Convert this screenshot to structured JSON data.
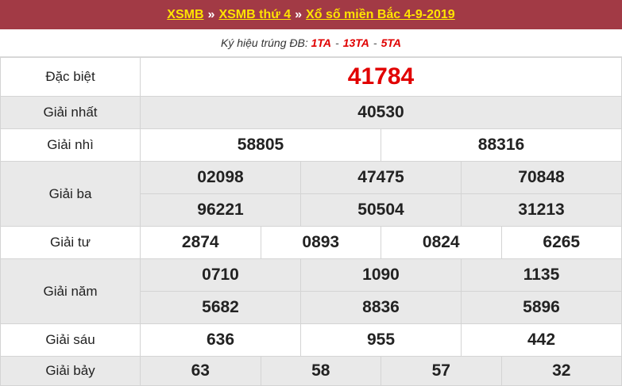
{
  "header": {
    "crumb1": "XSMB",
    "sep1": "»",
    "crumb2": "XSMB thứ 4",
    "sep2": "»",
    "title": "Xổ số miền Bắc 4-9-2019"
  },
  "subheader": {
    "prefix": "Ký hiệu trúng ĐB:",
    "codes": [
      "1TA",
      "13TA",
      "5TA"
    ],
    "separator": "-"
  },
  "results": {
    "dac_biet": {
      "label": "Đặc biệt",
      "numbers": [
        "41784"
      ]
    },
    "giai_nhat": {
      "label": "Giải nhất",
      "numbers": [
        "40530"
      ]
    },
    "giai_nhi": {
      "label": "Giải nhì",
      "numbers": [
        "58805",
        "88316"
      ]
    },
    "giai_ba": {
      "label": "Giải ba",
      "numbers": [
        "02098",
        "47475",
        "70848",
        "96221",
        "50504",
        "31213"
      ]
    },
    "giai_tu": {
      "label": "Giải tư",
      "numbers": [
        "2874",
        "0893",
        "0824",
        "6265"
      ]
    },
    "giai_nam": {
      "label": "Giải năm",
      "numbers": [
        "0710",
        "1090",
        "1135",
        "5682",
        "8836",
        "5896"
      ]
    },
    "giai_sau": {
      "label": "Giải sáu",
      "numbers": [
        "636",
        "955",
        "442"
      ]
    },
    "giai_bay": {
      "label": "Giải bảy",
      "numbers": [
        "63",
        "58",
        "57",
        "32"
      ]
    }
  },
  "colors": {
    "header_bg": "#a23a45",
    "header_link": "#ffe400",
    "special_number": "#e10000",
    "row_gray": "#e9e9e9"
  }
}
